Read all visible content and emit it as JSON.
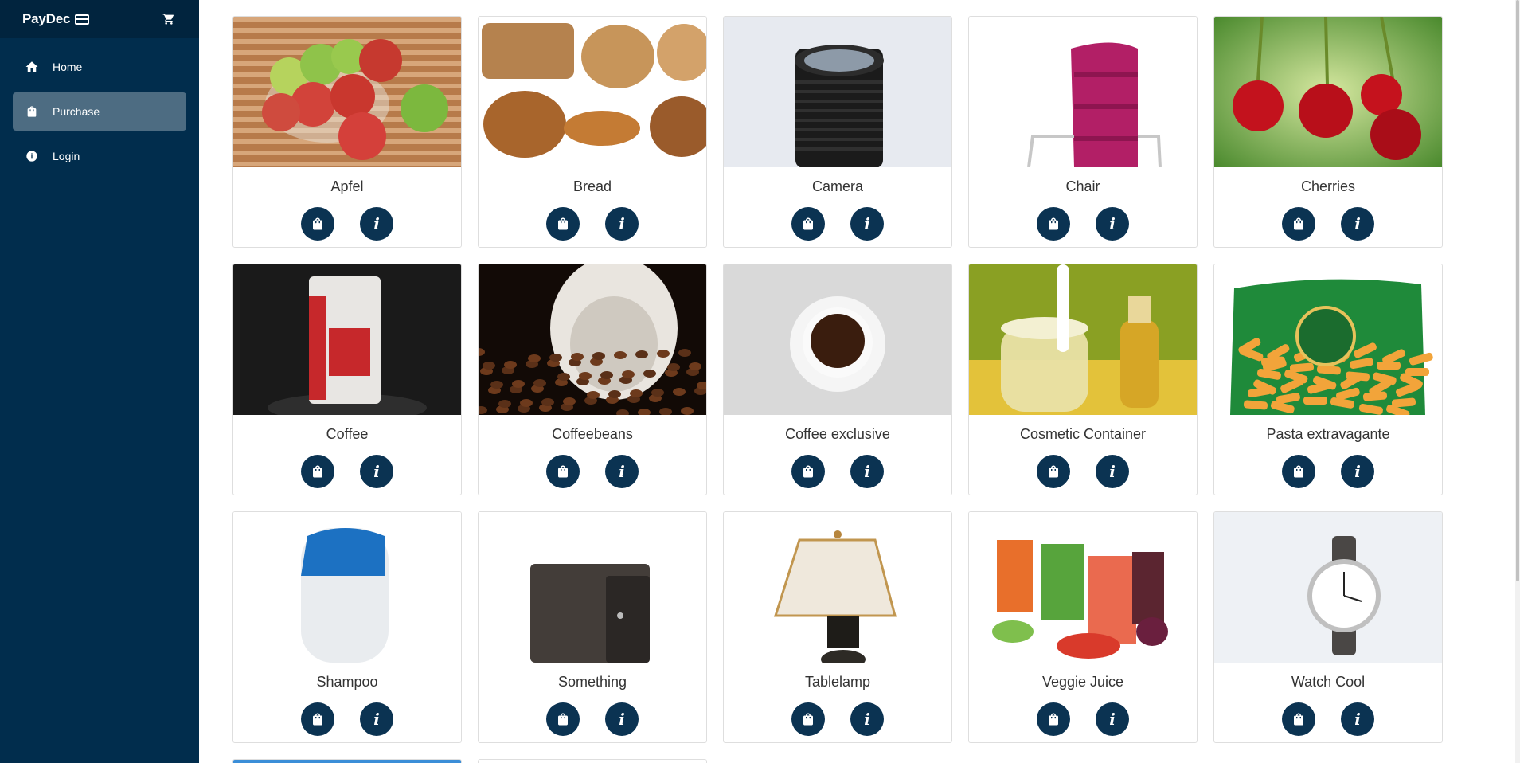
{
  "brand": {
    "name": "PayDec",
    "card_icon": "credit-card-icon",
    "cart_icon": "cart-icon"
  },
  "nav": [
    {
      "label": "Home",
      "icon": "home-icon",
      "active": false
    },
    {
      "label": "Purchase",
      "icon": "shopping-bag-icon",
      "active": true
    },
    {
      "label": "Login",
      "icon": "info-icon",
      "active": false
    }
  ],
  "products": [
    {
      "name": "Apfel",
      "theme": "apples"
    },
    {
      "name": "Bread",
      "theme": "bread"
    },
    {
      "name": "Camera",
      "theme": "camera"
    },
    {
      "name": "Chair",
      "theme": "chair"
    },
    {
      "name": "Cherries",
      "theme": "cherries"
    },
    {
      "name": "Coffee",
      "theme": "coffeebag"
    },
    {
      "name": "Coffeebeans",
      "theme": "beans"
    },
    {
      "name": "Coffee exclusive",
      "theme": "cup"
    },
    {
      "name": "Cosmetic Container",
      "theme": "cosmetic"
    },
    {
      "name": "Pasta extravagante",
      "theme": "pasta"
    },
    {
      "name": "Shampoo",
      "theme": "shampoo"
    },
    {
      "name": "Something",
      "theme": "wallet"
    },
    {
      "name": "Tablelamp",
      "theme": "lamp"
    },
    {
      "name": "Veggie Juice",
      "theme": "juice"
    },
    {
      "name": "Watch Cool",
      "theme": "watch"
    }
  ],
  "colors": {
    "sidebar": "#012d4d",
    "brandbar": "#01243e",
    "active": "#4d6c82",
    "button": "#0b3352"
  }
}
